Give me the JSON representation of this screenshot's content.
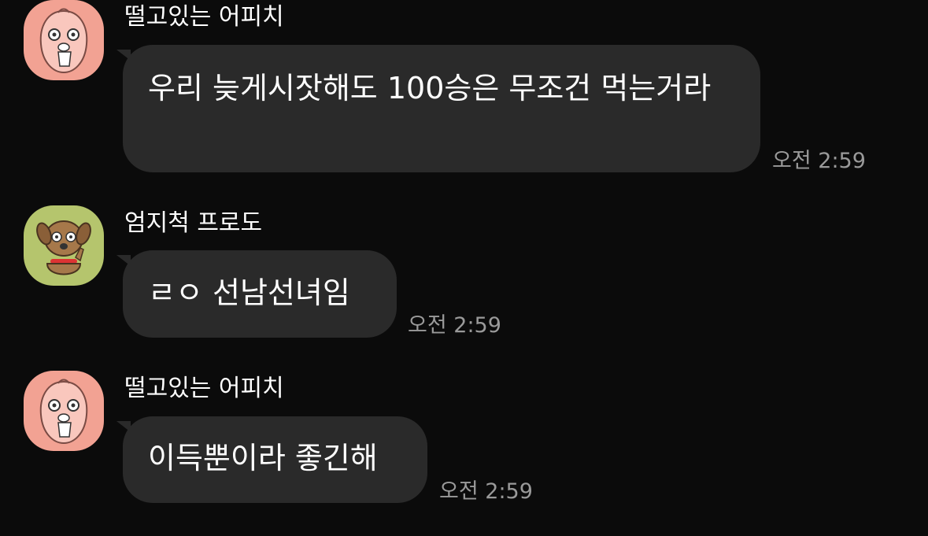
{
  "messages": [
    {
      "sender": "떨고있는 어피치",
      "avatar_icon": "apeach-avatar-icon",
      "avatar_bg": "#f2a293",
      "text": "우리 늦게시잣해도 100승은 무조건 먹는거라",
      "time": "오전 2:59"
    },
    {
      "sender": "엄지척 프로도",
      "avatar_icon": "frodo-avatar-icon",
      "avatar_bg": "#b5c56d",
      "text": "ㄹㅇ 선남선녀임",
      "time": "오전 2:59"
    },
    {
      "sender": "떨고있는 어피치",
      "avatar_icon": "apeach-avatar-icon",
      "avatar_bg": "#f2a293",
      "text": "이득뿐이라 좋긴해",
      "time": "오전 2:59"
    }
  ],
  "colors": {
    "background": "#0b0b0b",
    "bubble": "#2a2a2a",
    "text": "#ffffff",
    "time": "#9a9a9a"
  }
}
